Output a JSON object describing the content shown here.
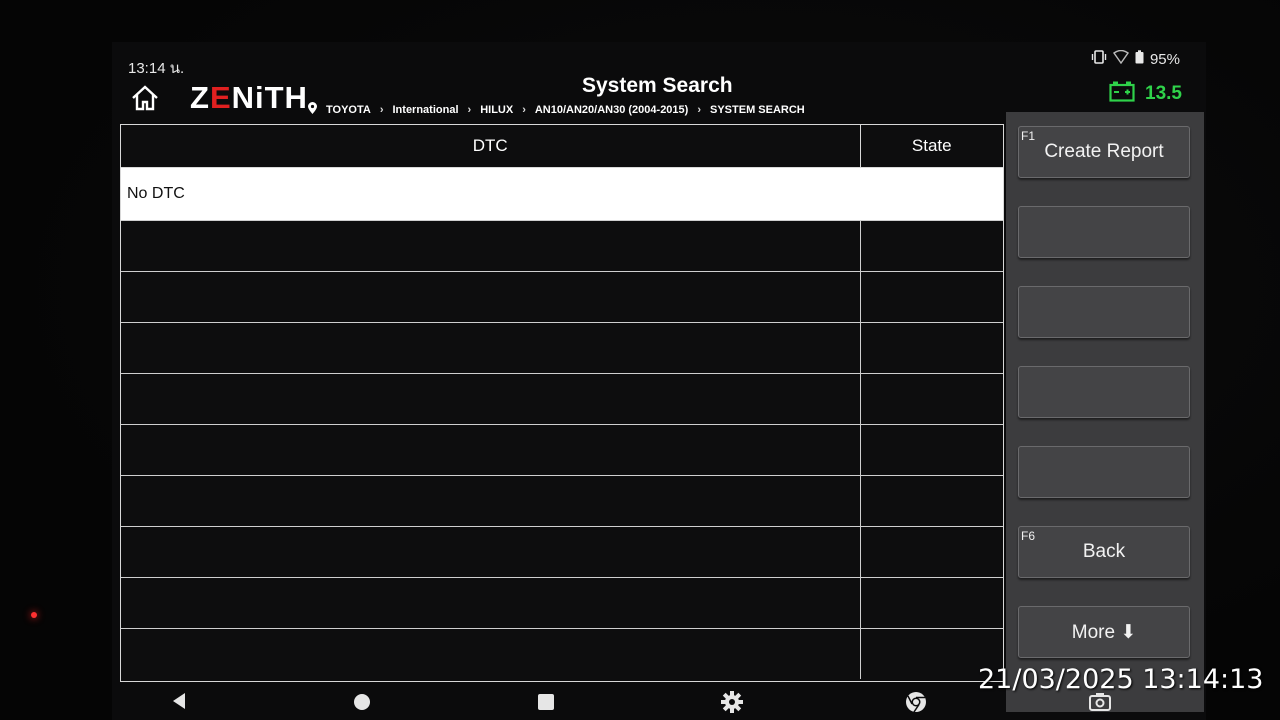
{
  "status_bar": {
    "time": "13:14 น.",
    "battery_percent": "95%"
  },
  "header": {
    "logo": {
      "part1": "Z",
      "part2": "E",
      "part3": "NiTH"
    },
    "title": "System Search",
    "breadcrumb": [
      "TOYOTA",
      "International",
      "HILUX",
      "AN10/AN20/AN30 (2004-2015)",
      "SYSTEM SEARCH"
    ],
    "voltage": "13.5"
  },
  "table": {
    "columns": [
      "DTC",
      "State"
    ],
    "rows": [
      {
        "dtc": "No DTC",
        "state": ""
      },
      {
        "dtc": "",
        "state": ""
      },
      {
        "dtc": "",
        "state": ""
      },
      {
        "dtc": "",
        "state": ""
      },
      {
        "dtc": "",
        "state": ""
      },
      {
        "dtc": "",
        "state": ""
      },
      {
        "dtc": "",
        "state": ""
      },
      {
        "dtc": "",
        "state": ""
      },
      {
        "dtc": "",
        "state": ""
      },
      {
        "dtc": "",
        "state": ""
      }
    ]
  },
  "function_keys": [
    {
      "key": "F1",
      "label": "Create Report"
    },
    {
      "key": "",
      "label": ""
    },
    {
      "key": "",
      "label": ""
    },
    {
      "key": "",
      "label": ""
    },
    {
      "key": "",
      "label": ""
    },
    {
      "key": "F6",
      "label": "Back"
    },
    {
      "key": "",
      "label": "More ⬇"
    }
  ],
  "photo_timestamp": "21/03/2025 13:14:13",
  "colors": {
    "battery_green": "#2fd24a",
    "logo_red": "#e02020",
    "panel_gray": "#3c3c3e"
  }
}
